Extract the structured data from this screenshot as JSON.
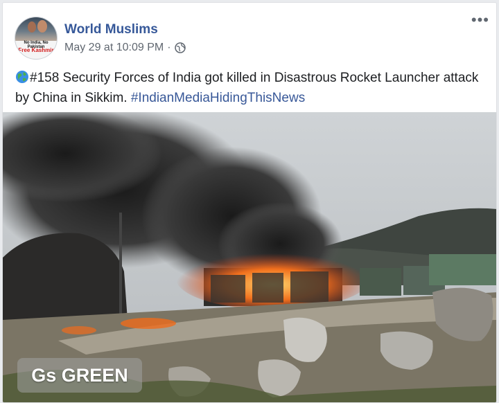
{
  "post": {
    "page_name": "World Muslims",
    "timestamp": "May 29 at 10:09 PM",
    "separator": "·",
    "privacy_icon": "globe-icon",
    "more_label": "•••",
    "text_main": "#158 Security Forces of India got killed in Disastrous Rocket Launcher attack by China in Sikkim.",
    "hashtag": "#IndianMediaHidingThisNews",
    "emoji": "globe-emoji"
  },
  "avatar": {
    "line1": "No India, No Pakistan",
    "line2": "Free Kashmir"
  },
  "photo": {
    "watermark": "Gs GREEN"
  },
  "colors": {
    "link": "#365899",
    "meta": "#606770",
    "text": "#1c1e21"
  }
}
